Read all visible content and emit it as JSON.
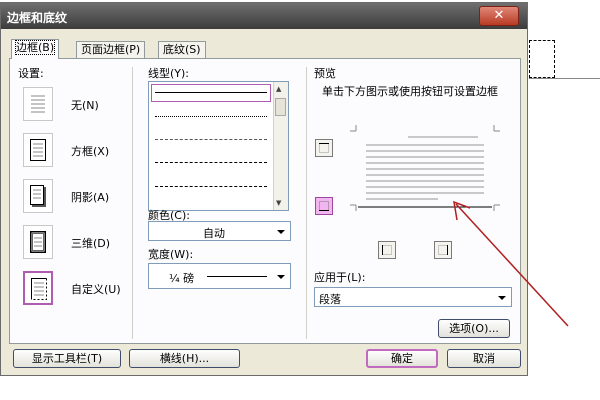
{
  "window": {
    "title": "边框和底纹"
  },
  "tabs": [
    {
      "label": "边框(B)"
    },
    {
      "label": "页面边框(P)"
    },
    {
      "label": "底纹(S)"
    }
  ],
  "settings": {
    "heading": "设置:",
    "options": [
      {
        "label": "无(N)"
      },
      {
        "label": "方框(X)"
      },
      {
        "label": "阴影(A)"
      },
      {
        "label": "三维(D)"
      },
      {
        "label": "自定义(U)"
      }
    ],
    "selected": "自定义(U)"
  },
  "style": {
    "line_type_label": "线型(Y):",
    "color_label": "颜色(C):",
    "color_value": "自动",
    "width_label": "宽度(W):",
    "width_value": "¼ 磅"
  },
  "preview": {
    "heading": "预览",
    "hint": "单击下方图示或使用按钮可设置边框"
  },
  "apply_to": {
    "label": "应用于(L):",
    "value": "段落"
  },
  "buttons": {
    "options": "选项(O)...",
    "show_toolbar": "显示工具栏(T)",
    "horizontal_line": "横线(H)...",
    "ok": "确定",
    "cancel": "取消"
  },
  "colors": {
    "accent_pink": "#c06ac0",
    "annotation_arrow": "#b02020"
  }
}
